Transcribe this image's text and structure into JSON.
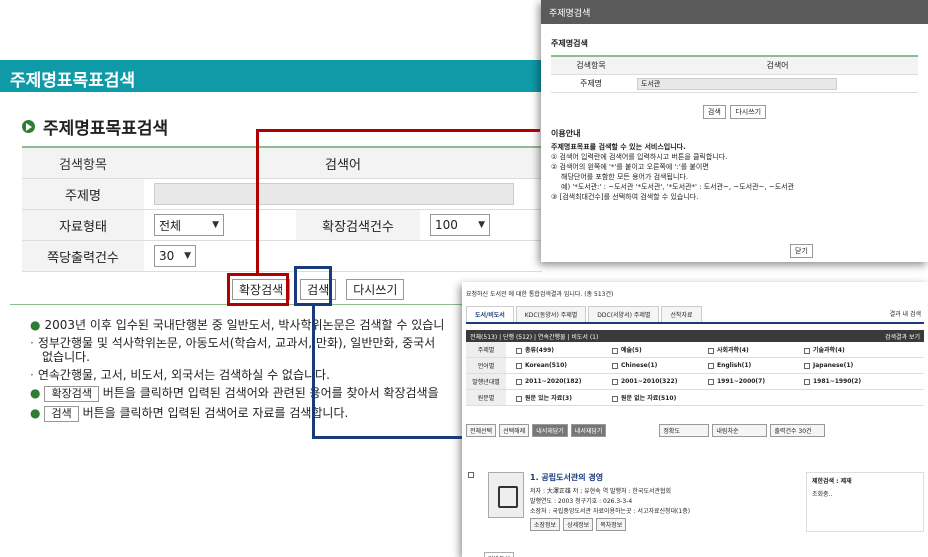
{
  "main": {
    "header": "주제명표목표검색",
    "section_title": "주제명표목표검색",
    "form": {
      "col_field": "검색항목",
      "col_keyword": "검색어",
      "subject_label": "주제명",
      "type_label": "자료형태",
      "type_value": "전체",
      "expand_label": "확장검색건수",
      "expand_value": "100",
      "per_page_label": "쪽당출력건수",
      "per_page_value": "30"
    },
    "buttons": {
      "expand": "확장검색",
      "search": "검색",
      "reset": "다시쓰기"
    },
    "info": [
      "2003년 이후 입수된 국내단행본 중 일반도서, 박사학위논문은 검색할 수 있습니",
      "정부간행물 및 석사학위논문, 아동도서(학습서, 교과서, 만화), 일반만화, 중국서",
      "없습니다.",
      "연속간행물, 고서, 비도서, 외국서는 검색하실 수 없습니다.",
      "버튼을 클릭하면 입력된 검색어와 관련된 용어를 찾아서 확장검색을",
      "버튼을 클릭하면 입력된 검색어로 자료를 검색합니다."
    ],
    "info_btn_expand": "확장검색",
    "info_btn_search": "검색"
  },
  "popup": {
    "header": "주제명검색",
    "title": "주제명검색",
    "col_field": "검색항목",
    "col_keyword": "검색어",
    "subject_label": "주제명",
    "subject_value": "도서관",
    "btn_search": "검색",
    "btn_reset": "다시쓰기",
    "guide_title": "이용안내",
    "guide_head": "주제명표목표를 검색할 수 있는 서비스입니다.",
    "guide_1": "① 검색어 입력란에 검색어를 입력하시고 버튼을 클릭합니다.",
    "guide_2a": "② 검색어의 왼쪽에 '*'를 붙이고 오른쪽에 ':'를 붙이면",
    "guide_2b": "해당단어를 포함한 모든 용어가 검색됩니다.",
    "guide_2c": "예) '*도서관:' : ~도서관 '*도서관', '*도서관*' : 도서관~, ~도서관~, ~도서관",
    "guide_3": "③ [검색최대건수]를 선택하여 검색할 수 있습니다.",
    "btn_close": "닫기"
  },
  "results": {
    "top_line": "요청하신 도서관 에 대한 통합검색결과 입니다. (총 513건)",
    "tabs": [
      "도서/비도서",
      "KDC(동양서) 주제별",
      "DDC(서양서) 주제별",
      "선착자료"
    ],
    "search_in": "결과 내 검색",
    "filter_bar": "전체(513) | 단행 (512) | 연속간행물 | 비도서 (1)",
    "filter_more": "검색결과 보기",
    "grid": [
      {
        "label": "주제별",
        "items": [
          "총류(499)",
          "예술(5)",
          "사회과학(4)",
          "기술과학(4)"
        ]
      },
      {
        "label": "언어별",
        "items": [
          "Korean(510)",
          "Chinese(1)",
          "English(1)",
          "Japanese(1)"
        ]
      },
      {
        "label": "발행년대별",
        "items": [
          "2011~2020(182)",
          "2001~2010(322)",
          "1991~2000(7)",
          "1981~1990(2)"
        ]
      },
      {
        "label": "원문별",
        "items": [
          "원문 있는 자료(3)",
          "원문 없는 자료(510)"
        ]
      }
    ],
    "toolbar": [
      "전체선택",
      "선택해제",
      "내서재담기",
      "내서재담기"
    ],
    "sort": "정확도",
    "sort2": "내림차순",
    "per_page": "출력건수 30건",
    "item": {
      "title": "1. 공립도서관의 경영",
      "author": "저자 : 大澤正雄 저 ; 유현숙 역   발행처 : 한국도서관협회",
      "year": "발행연도 : 2003   청구기호 : 026.3-3-4",
      "location": "소장처 : 국립중앙도서관   자료이용하는곳 : 서고자료신청대(1층)",
      "buttons": [
        "소장정보",
        "상세정보",
        "목차정보"
      ],
      "type": "일반도서",
      "side_title": "제한검색 : 제재",
      "side_text": "조회중.."
    }
  }
}
